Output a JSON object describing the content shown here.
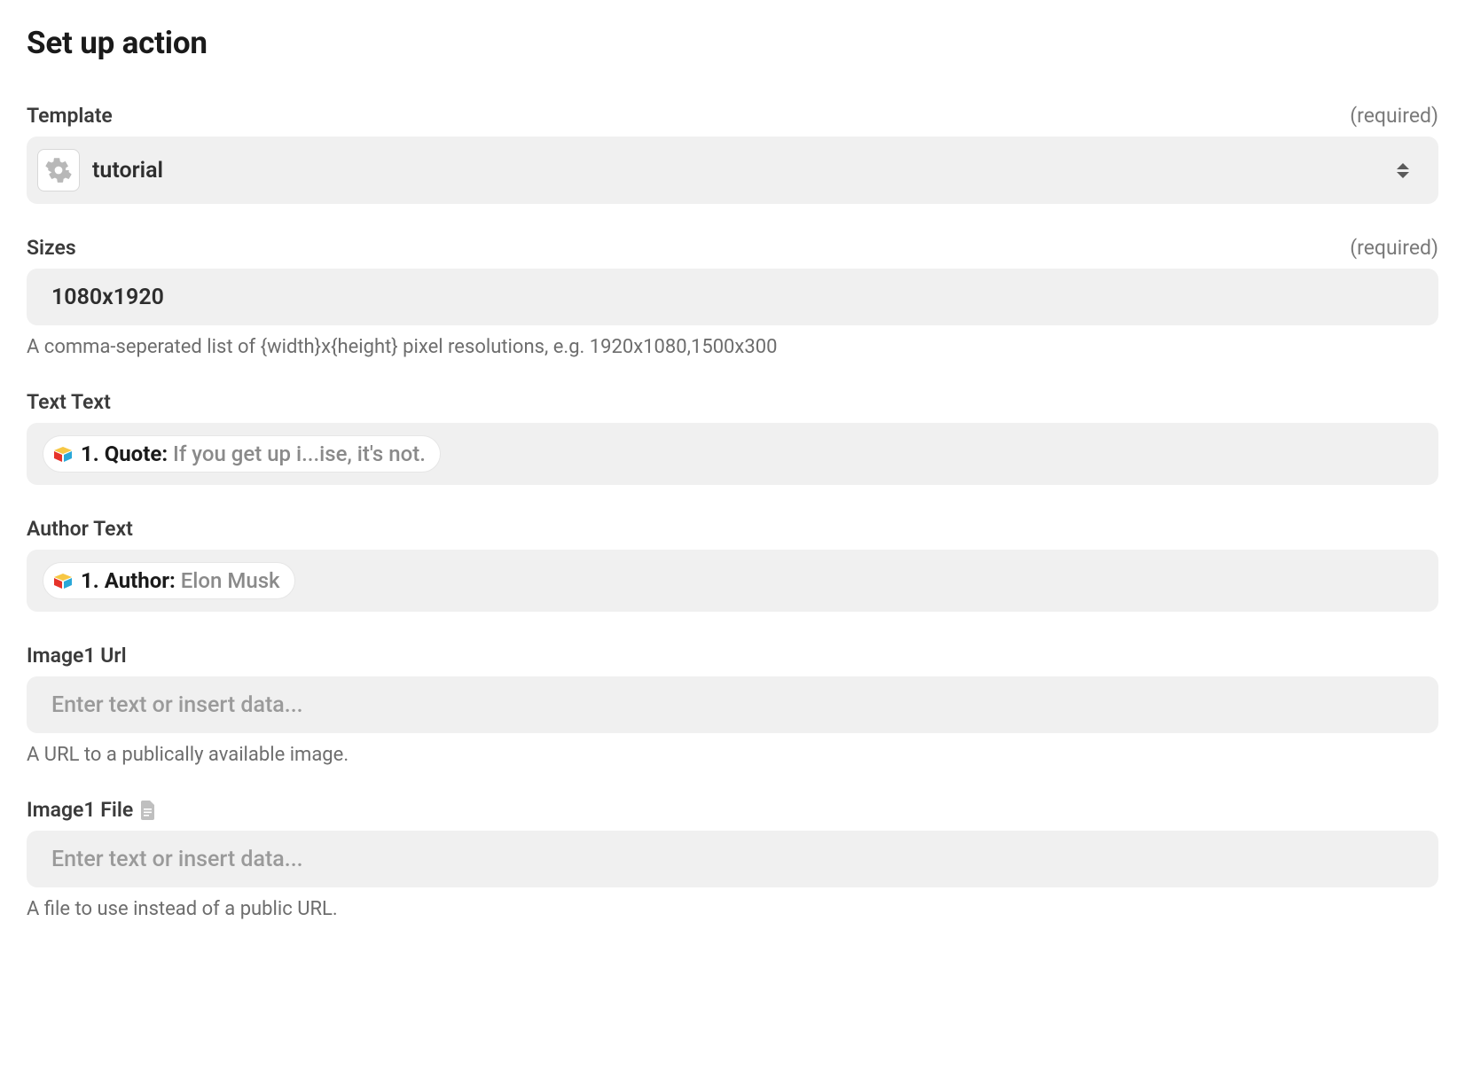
{
  "page_title": "Set up action",
  "required_text": "(required)",
  "fields": {
    "template": {
      "label": "Template",
      "value": "tutorial"
    },
    "sizes": {
      "label": "Sizes",
      "value": "1080x1920",
      "help": "A comma-seperated list of {width}x{height} pixel resolutions, e.g. 1920x1080,1500x300"
    },
    "text_text": {
      "label": "Text Text",
      "pill_label": "1. Quote:",
      "pill_value": "If you get up i...ise, it's not."
    },
    "author_text": {
      "label": "Author Text",
      "pill_label": "1. Author:",
      "pill_value": "Elon Musk"
    },
    "image1_url": {
      "label": "Image1 Url",
      "placeholder": "Enter text or insert data...",
      "help": "A URL to a publically available image."
    },
    "image1_file": {
      "label": "Image1 File",
      "placeholder": "Enter text or insert data...",
      "help": "A file to use instead of a public URL."
    }
  }
}
